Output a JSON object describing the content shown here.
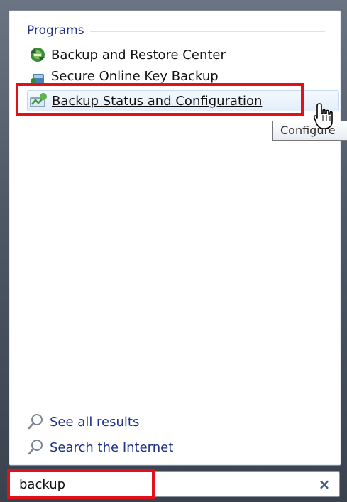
{
  "programs": {
    "header": "Programs",
    "items": [
      {
        "label": "Backup and Restore Center",
        "icon": "backup-restore-icon"
      },
      {
        "label": "Secure Online Key Backup",
        "icon": "key-backup-icon"
      },
      {
        "label": "Backup Status and Configuration",
        "icon": "backup-status-icon",
        "hovered": true
      }
    ]
  },
  "tooltip": {
    "text": "Configure"
  },
  "links": {
    "see_all": "See all results",
    "search_internet": "Search the Internet"
  },
  "search": {
    "value": "backup",
    "clear_glyph": "×"
  },
  "colors": {
    "highlight_red": "#e2101a",
    "link_blue": "#1e3287",
    "hover_bg": "#e3eefb"
  }
}
